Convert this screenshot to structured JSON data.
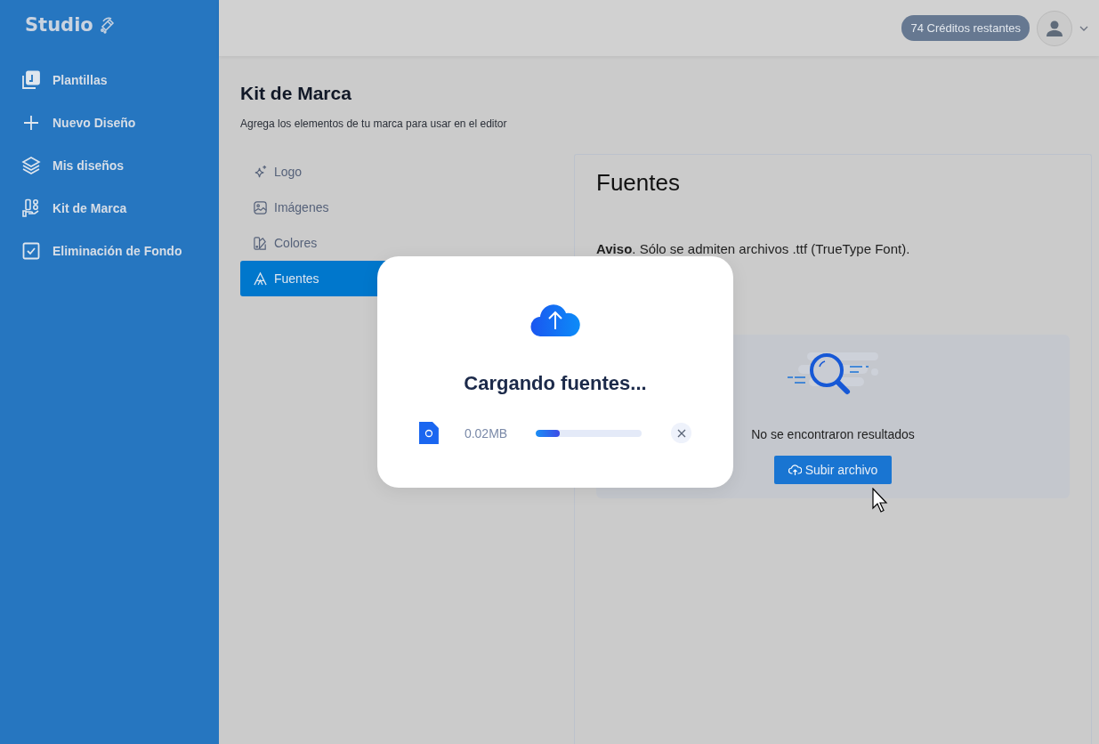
{
  "sidebar": {
    "logo": "Studio",
    "items": [
      {
        "label": "Plantillas",
        "selected": false
      },
      {
        "label": "Nuevo Diseño",
        "selected": false
      },
      {
        "label": "Mis diseños",
        "selected": false
      },
      {
        "label": "Kit de Marca",
        "selected": false
      },
      {
        "label": "Eliminación de Fondo",
        "selected": false
      }
    ]
  },
  "header": {
    "credits": "74 Créditos restantes"
  },
  "page": {
    "title": "Kit de Marca",
    "subtitle": "Agrega los elementos de tu marca para usar en el editor",
    "tabs": [
      {
        "label": "Logo",
        "selected": false
      },
      {
        "label": "Imágenes",
        "selected": false
      },
      {
        "label": "Colores",
        "selected": false
      },
      {
        "label": "Fuentes",
        "selected": true
      }
    ],
    "panel": {
      "title": "Fuentes",
      "notice": "**Aviso**. Sólo se admiten archivos .ttf (TrueType Font).",
      "empty_text": "No se encontraron resultados",
      "upload_button": "Subir archivo"
    }
  },
  "modal": {
    "title": "Cargando fuentes...",
    "file_size": "0.02MB",
    "level": 0.23
  }
}
